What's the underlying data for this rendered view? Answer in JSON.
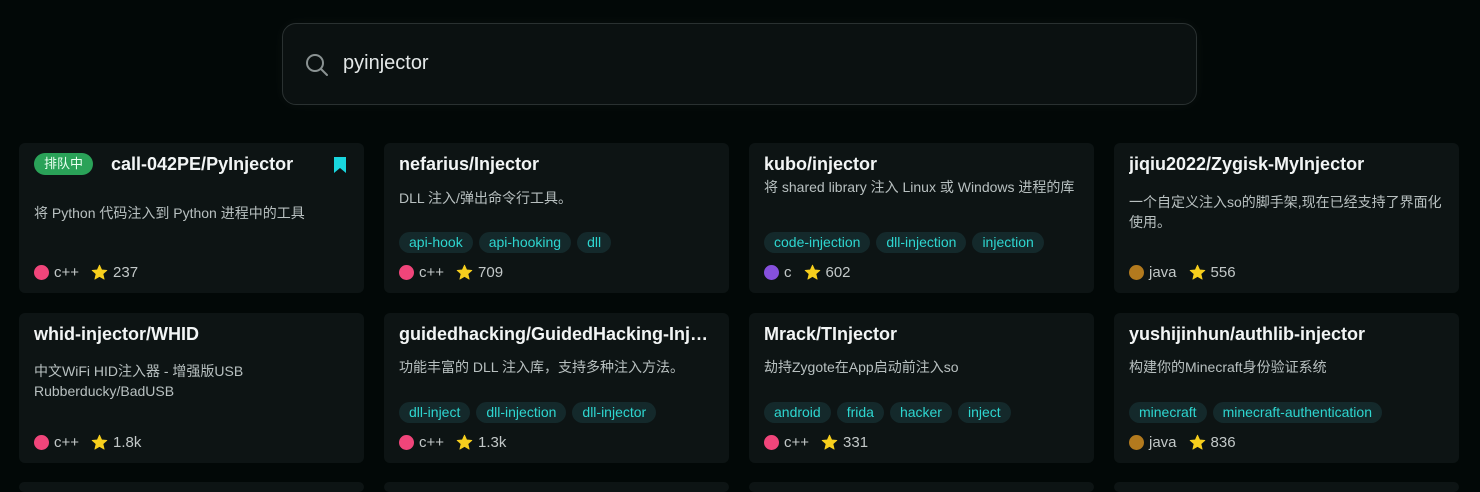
{
  "search": {
    "icon": "search-icon",
    "value": "pyinjector"
  },
  "colors": {
    "c++": "#f0457a",
    "c": "#8650dd",
    "java": "#b27a1e",
    "badge": "#2aa258",
    "tag_text": "#2ed6d0",
    "star": "#f7cf1d",
    "bookmark": "#19d6de"
  },
  "cards": [
    {
      "title": "call-042PE/PyInjector",
      "badge": "排队中",
      "bookmarked": true,
      "description": "将 Python 代码注入到 Python 进程中的工具",
      "tags": [],
      "language": "c++",
      "stars": "237"
    },
    {
      "title": "nefarius/Injector",
      "description": "DLL 注入/弹出命令行工具。",
      "tags": [
        "api-hook",
        "api-hooking",
        "dll"
      ],
      "language": "c++",
      "stars": "709"
    },
    {
      "title": "kubo/injector",
      "description": "将 shared library 注入 Linux 或 Windows 进程的库",
      "tags": [
        "code-injection",
        "dll-injection",
        "injection"
      ],
      "language": "c",
      "stars": "602"
    },
    {
      "title": "jiqiu2022/Zygisk-MyInjector",
      "description": "一个自定义注入so的脚手架,现在已经支持了界面化使用。",
      "tags": [],
      "language": "java",
      "stars": "556"
    },
    {
      "title": "whid-injector/WHID",
      "description": "中文WiFi HID注入器 - 增强版USB Rubberducky/BadUSB",
      "tags": [],
      "language": "c++",
      "stars": "1.8k"
    },
    {
      "title": "guidedhacking/GuidedHacking-Injector",
      "description": "功能丰富的 DLL 注入库，支持多种注入方法。",
      "tags": [
        "dll-inject",
        "dll-injection",
        "dll-injector"
      ],
      "language": "c++",
      "stars": "1.3k"
    },
    {
      "title": "Mrack/TInjector",
      "description": "劫持Zygote在App启动前注入so",
      "tags": [
        "android",
        "frida",
        "hacker",
        "inject"
      ],
      "language": "c++",
      "stars": "331"
    },
    {
      "title": "yushijinhun/authlib-injector",
      "description": "构建你的Minecraft身份验证系统",
      "tags": [
        "minecraft",
        "minecraft-authentication"
      ],
      "language": "java",
      "stars": "836"
    }
  ]
}
